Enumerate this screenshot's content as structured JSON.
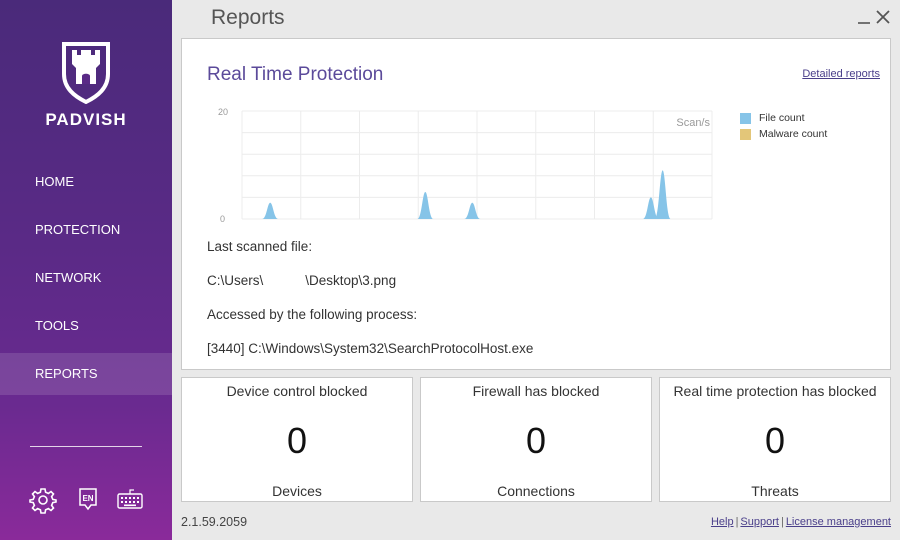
{
  "app": {
    "brand": "PADVISH"
  },
  "sidebar": {
    "items": [
      {
        "label": "HOME"
      },
      {
        "label": "PROTECTION"
      },
      {
        "label": "NETWORK"
      },
      {
        "label": "TOOLS"
      },
      {
        "label": "REPORTS",
        "active": true
      }
    ],
    "bottom_icons": [
      "gear-icon",
      "language-en-icon",
      "keyboard-icon"
    ],
    "language_badge": "EN"
  },
  "main": {
    "title": "Reports",
    "rtp": {
      "title": "Real Time Protection",
      "detailed_link": "Detailed reports",
      "last_scanned_label": "Last scanned file:",
      "last_scanned_path_a": "C:\\Users\\",
      "last_scanned_path_b": "\\Desktop\\3.png",
      "process_label": "Accessed by the following process:",
      "process_value": "[3440] C:\\Windows\\System32\\SearchProtocolHost.exe"
    },
    "stats": [
      {
        "title": "Device control blocked",
        "value": "0",
        "unit": "Devices"
      },
      {
        "title": "Firewall has blocked",
        "value": "0",
        "unit": "Connections"
      },
      {
        "title": "Real time protection has blocked",
        "value": "0",
        "unit": "Threats"
      }
    ],
    "footer": {
      "version": "2.1.59.2059",
      "links": [
        "Help",
        "Support",
        "License management"
      ]
    }
  },
  "chart_data": {
    "type": "area",
    "unit_label": "Scan/s",
    "ylim": [
      0,
      20
    ],
    "y_ticks": [
      "20",
      "0"
    ],
    "grid": true,
    "legend_position": "right",
    "series": [
      {
        "name": "File count",
        "color": "#86c4e8",
        "peaks": [
          {
            "t": 0.06,
            "value": 3
          },
          {
            "t": 0.39,
            "value": 5
          },
          {
            "t": 0.49,
            "value": 3
          },
          {
            "t": 0.87,
            "value": 4
          },
          {
            "t": 0.895,
            "value": 9
          }
        ]
      },
      {
        "name": "Malware count",
        "color": "#e3c679",
        "peaks": []
      }
    ]
  },
  "colors": {
    "accent": "#5b4a9a",
    "sidebar": "#5a2a86"
  }
}
